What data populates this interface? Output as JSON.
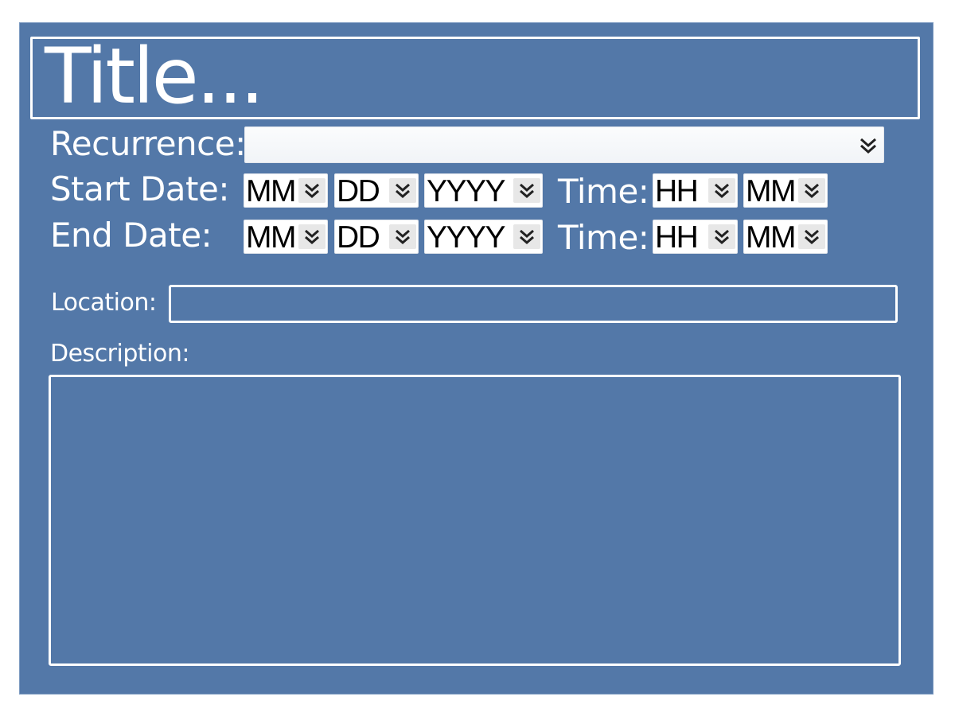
{
  "form": {
    "title_placeholder": "Title...",
    "recurrence": {
      "label": "Recurrence:",
      "value": ""
    },
    "start": {
      "label": "Start Date:",
      "month": "MM",
      "day": "DD",
      "year": "YYYY",
      "time_label": "Time:",
      "hour": "HH",
      "minute": "MM"
    },
    "end": {
      "label": "End Date:",
      "month": "MM",
      "day": "DD",
      "year": "YYYY",
      "time_label": "Time:",
      "hour": "HH",
      "minute": "MM"
    },
    "location": {
      "label": "Location:",
      "value": ""
    },
    "description": {
      "label": "Description:",
      "value": ""
    }
  },
  "icons": {
    "dropdown_arrow": "double-chevron-down-icon"
  },
  "colors": {
    "panel_background": "#5378a8",
    "field_border": "#ffffff",
    "label_text": "#ffffff",
    "dropdown_background": "#ffffff",
    "dropdown_button": "#e7e7e7"
  }
}
